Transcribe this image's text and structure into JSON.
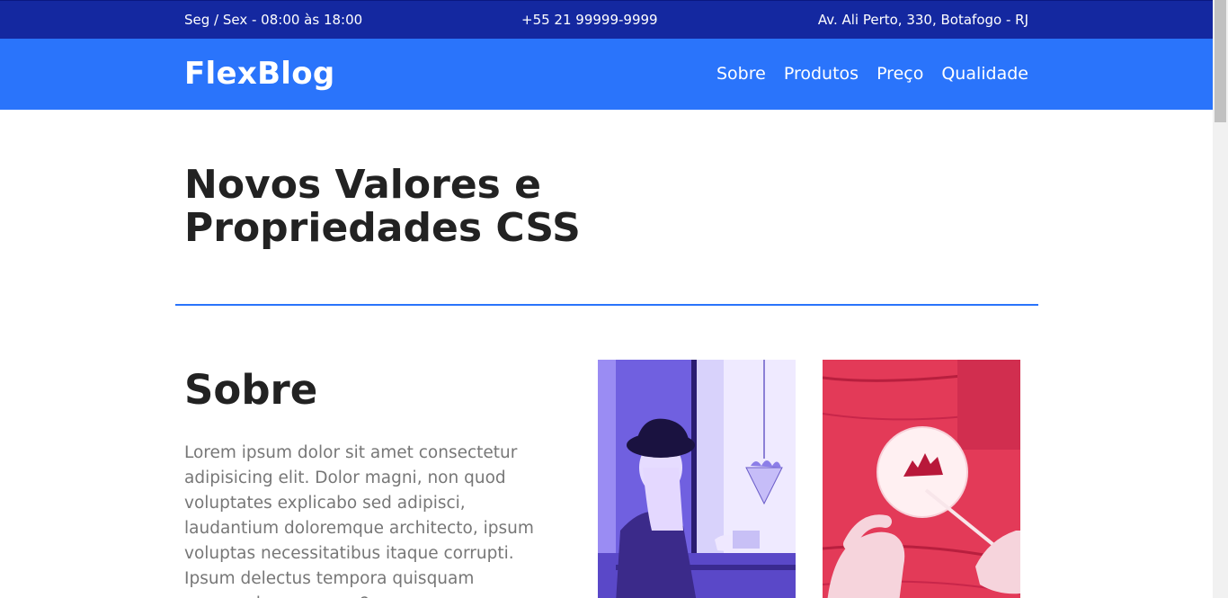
{
  "topbar": {
    "hours": "Seg / Sex - 08:00 às 18:00",
    "phone": "+55 21 99999-9999",
    "address": "Av. Ali Perto, 330, Botafogo - RJ"
  },
  "header": {
    "logo": "FlexBlog",
    "nav": [
      "Sobre",
      "Produtos",
      "Preço",
      "Qualidade"
    ]
  },
  "intro": {
    "title": "Novos Valores e Propriedades CSS"
  },
  "sobre": {
    "title": "Sobre",
    "text": "Lorem ipsum dolor sit amet consectetur adipisicing elit. Dolor magni, non quod voluptates explicabo sed adipisci, laudantium doloremque architecto, ipsum voluptas necessitatibus itaque corrupti. Ipsum delectus tempora quisquam recusandae magnam?"
  },
  "colors": {
    "topbar": "#1428a0",
    "header": "#2a74fb",
    "accent": "#2a74fb",
    "photo1_tint": "#7c6ee8",
    "photo2_tint": "#e8304f"
  }
}
